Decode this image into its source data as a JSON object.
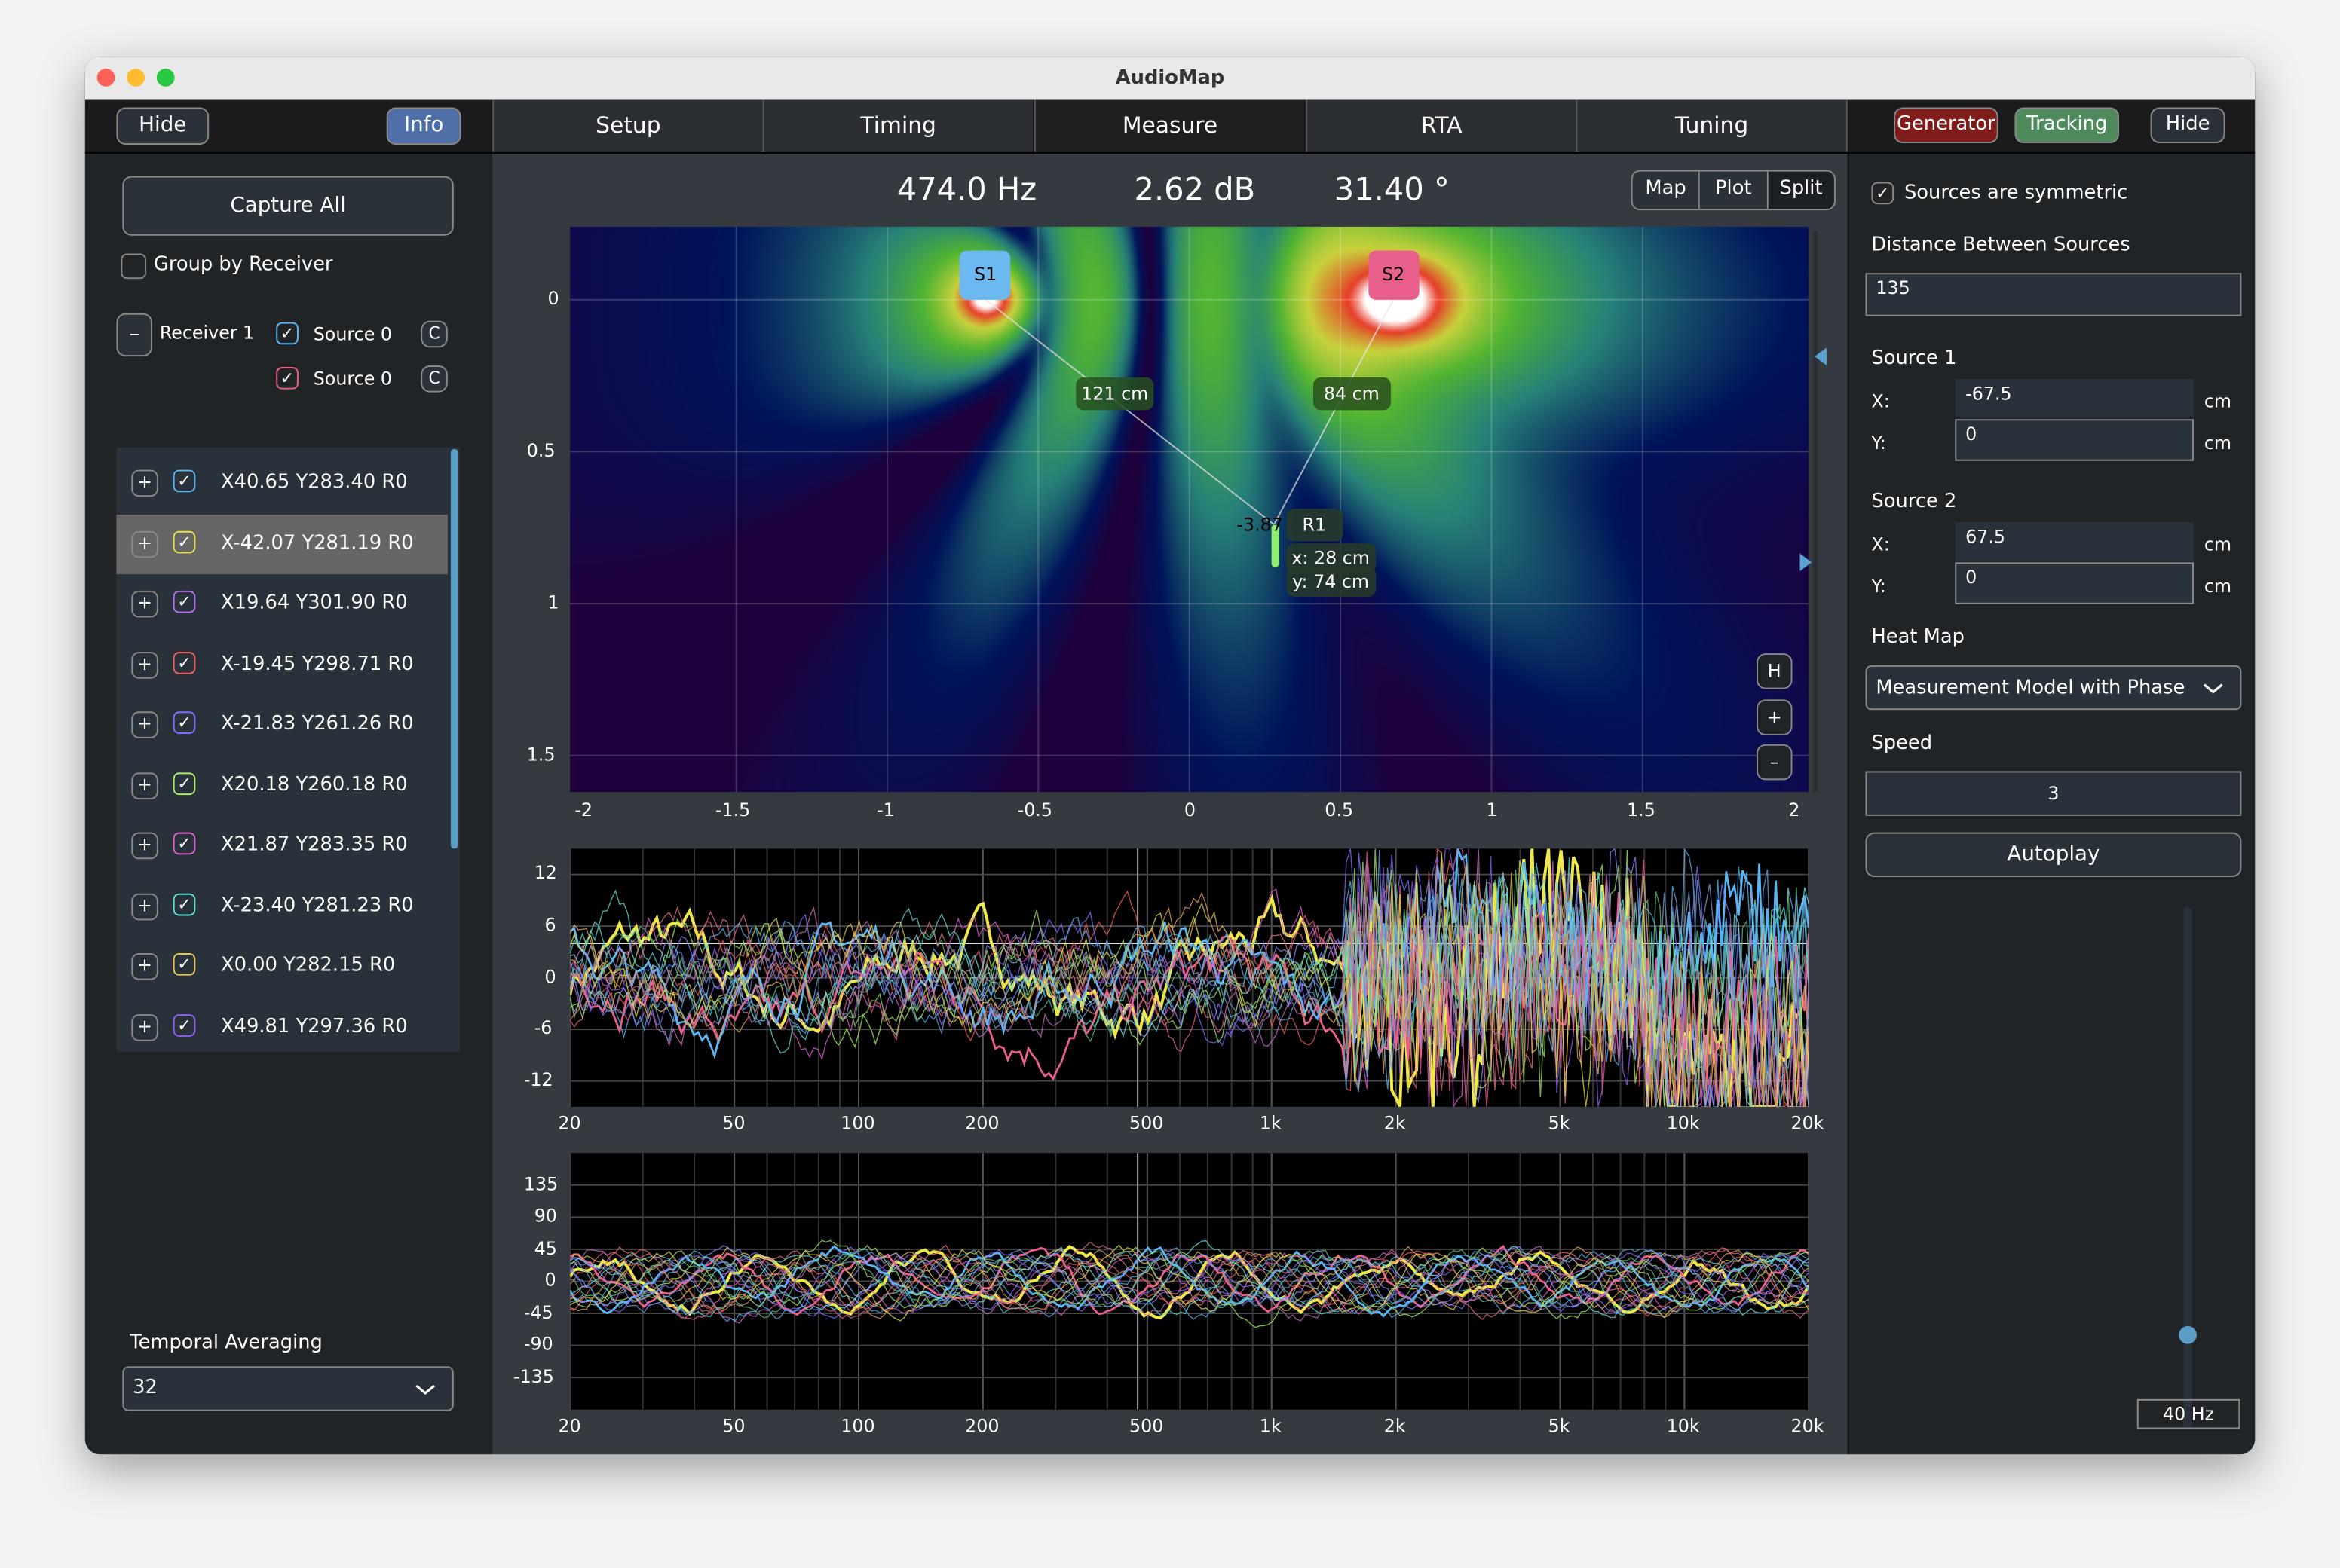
{
  "window": {
    "title": "AudioMap"
  },
  "toolbar": {
    "left_hide": "Hide",
    "info": "Info",
    "tabs": [
      {
        "label": "Setup"
      },
      {
        "label": "Timing"
      },
      {
        "label": "Measure",
        "selected": true
      },
      {
        "label": "RTA"
      },
      {
        "label": "Tuning"
      }
    ],
    "generator": "Generator",
    "tracking": "Tracking",
    "right_hide": "Hide",
    "colors": {
      "info": "#4f6fa8",
      "generator": "#7f1d1a",
      "tracking": "#4e8a5c"
    }
  },
  "left": {
    "capture_all": "Capture All",
    "group_by_receiver": {
      "label": "Group by Receiver",
      "checked": false
    },
    "receiver": {
      "collapse": "–",
      "label": "Receiver 1",
      "sources": [
        {
          "label": "Source 0",
          "checked": true,
          "color": "#5ab4f0",
          "button": "C"
        },
        {
          "label": "Source 0",
          "checked": true,
          "color": "#e8608a",
          "button": "C"
        }
      ]
    },
    "measurements": [
      {
        "label": "X40.65 Y283.40 R0",
        "color": "#5ab4f0",
        "checked": true
      },
      {
        "label": "X-42.07 Y281.19 R0",
        "color": "#e8e04a",
        "checked": true,
        "selected": true
      },
      {
        "label": "X19.64 Y301.90 R0",
        "color": "#b070f0",
        "checked": true
      },
      {
        "label": "X-19.45 Y298.71 R0",
        "color": "#f06060",
        "checked": true
      },
      {
        "label": "X-21.83 Y261.26 R0",
        "color": "#7a70ff",
        "checked": true
      },
      {
        "label": "X20.18 Y260.18 R0",
        "color": "#a8f060",
        "checked": true
      },
      {
        "label": "X21.87 Y283.35 R0",
        "color": "#e060d0",
        "checked": true
      },
      {
        "label": "X-23.40 Y281.23 R0",
        "color": "#60e0d8",
        "checked": true
      },
      {
        "label": "X0.00 Y282.15 R0",
        "color": "#e8c84a",
        "checked": true
      },
      {
        "label": "X49.81 Y297.36 R0",
        "color": "#9060f0",
        "checked": true
      }
    ],
    "plus": "+",
    "temporal_averaging": {
      "label": "Temporal Averaging",
      "value": "32"
    }
  },
  "center": {
    "readout": {
      "frequency": "474.0 Hz",
      "level": "2.62 dB",
      "phase": "31.40 °"
    },
    "view_buttons": [
      {
        "label": "Map"
      },
      {
        "label": "Plot"
      },
      {
        "label": "Split",
        "selected": true
      }
    ],
    "heatmap": {
      "x_ticks": [
        "-2",
        "-1.5",
        "-1",
        "-0.5",
        "0",
        "0.5",
        "1",
        "1.5",
        "2"
      ],
      "y_ticks": [
        "0",
        "0.5",
        "1",
        "1.5"
      ],
      "xlim": [
        -2.05,
        2.05
      ],
      "ylim": [
        -0.24,
        1.62
      ],
      "frequency_hz": 474,
      "sources": [
        {
          "label": "S1",
          "color": "#6cb8f0"
        },
        {
          "label": "S2",
          "color": "#e85f8c"
        }
      ],
      "distances": [
        "121 cm",
        "84 cm"
      ],
      "receiver": {
        "label": "R1",
        "value": "-3.87 ...",
        "x": "x: 28 cm",
        "y": "y: 74 cm"
      },
      "buttons": {
        "h": "H",
        "zoom_in": "+",
        "zoom_out": "–"
      }
    },
    "magnitude_plot": {
      "y_ticks": [
        "12",
        "6",
        "0",
        "-6",
        "-12"
      ],
      "ylim": [
        -15,
        15
      ],
      "x_ticks": [
        "20",
        "50",
        "100",
        "200",
        "500",
        "1k",
        "2k",
        "5k",
        "10k",
        "20k"
      ]
    },
    "phase_plot": {
      "y_ticks": [
        "135",
        "90",
        "45",
        "0",
        "-45",
        "-90",
        "-135"
      ],
      "ylim": [
        -180,
        180
      ],
      "x_ticks": [
        "20",
        "50",
        "100",
        "200",
        "500",
        "1k",
        "2k",
        "5k",
        "10k",
        "20k"
      ]
    }
  },
  "right": {
    "symmetric": {
      "label": "Sources are symmetric",
      "checked": true
    },
    "distance_label": "Distance Between Sources",
    "distance_value": "135",
    "source1": {
      "label": "Source 1",
      "x_label": "X:",
      "x": "-67.5",
      "y_label": "Y:",
      "y": "0",
      "unit": "cm"
    },
    "source2": {
      "label": "Source 2",
      "x_label": "X:",
      "x": "67.5",
      "y_label": "Y:",
      "y": "0",
      "unit": "cm"
    },
    "heat_map_label": "Heat Map",
    "heat_map_value": "Measurement Model with Phase",
    "speed_label": "Speed",
    "speed_value": "3",
    "autoplay": "Autoplay",
    "frequency_slider": {
      "value_label": "40 Hz",
      "position": 0.1
    }
  }
}
